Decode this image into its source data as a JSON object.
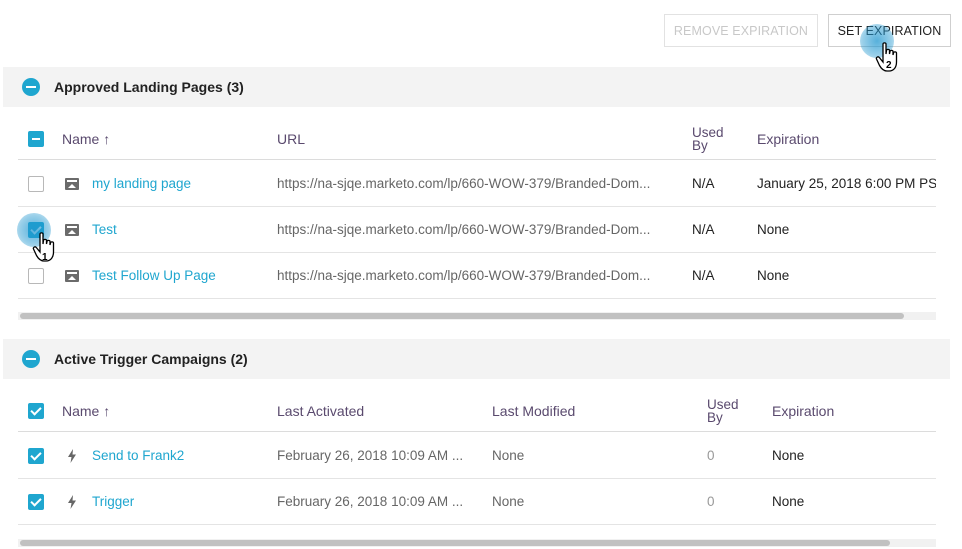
{
  "toolbar": {
    "remove_expiration": "REMOVE EXPIRATION",
    "set_expiration": "SET EXPIRATION"
  },
  "landing_pages": {
    "title": "Approved Landing Pages (3)",
    "headers": {
      "name": "Name ↑",
      "url": "URL",
      "used_by_1": "Used",
      "used_by_2": "By",
      "expiration": "Expiration"
    },
    "rows": [
      {
        "name": "my landing page",
        "url": "https://na-sjqe.marketo.com/lp/660-WOW-379/Branded-Dom...",
        "used_by": "N/A",
        "expiration": "January 25, 2018 6:00 PM PS",
        "checked": false
      },
      {
        "name": "Test",
        "url": "https://na-sjqe.marketo.com/lp/660-WOW-379/Branded-Dom...",
        "used_by": "N/A",
        "expiration": "None",
        "checked": true
      },
      {
        "name": "Test Follow Up Page",
        "url": "https://na-sjqe.marketo.com/lp/660-WOW-379/Branded-Dom...",
        "used_by": "N/A",
        "expiration": "None",
        "checked": false
      }
    ]
  },
  "campaigns": {
    "title": "Active Trigger Campaigns (2)",
    "headers": {
      "name": "Name ↑",
      "last_activated": "Last Activated",
      "last_modified": "Last Modified",
      "used_by_1": "Used",
      "used_by_2": "By",
      "expiration": "Expiration"
    },
    "rows": [
      {
        "name": "Send to Frank2",
        "last_activated": "February 26, 2018 10:09 AM ...",
        "last_modified": "None",
        "used_by": "0",
        "expiration": "None",
        "checked": true
      },
      {
        "name": "Trigger",
        "last_activated": "February 26, 2018 10:09 AM ...",
        "last_modified": "None",
        "used_by": "0",
        "expiration": "None",
        "checked": true
      }
    ]
  },
  "annotations": {
    "step1": "1",
    "step2": "2"
  },
  "colors": {
    "accent": "#1fa6cf",
    "header_text": "#5a4a6e",
    "section_bg": "#f3f3f3"
  }
}
